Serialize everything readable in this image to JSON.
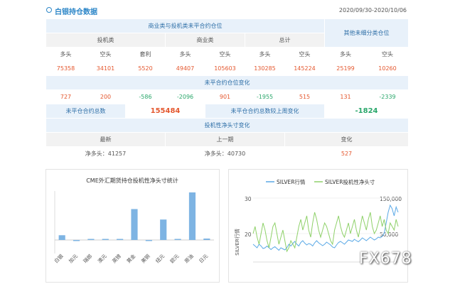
{
  "header": {
    "title": "白银持仓数据",
    "date_range": "2020/09/30-2020/10/06"
  },
  "table": {
    "group_noncommercial": "商业类与投机类未平合约仓位",
    "group_other": "其他未细分类仓位",
    "sub_speculative": "投机类",
    "sub_commercial": "商业类",
    "sub_total": "总计",
    "col_long": "多头",
    "col_short": "空头",
    "col_spread": "套利",
    "values": [
      "75358",
      "34101",
      "5520",
      "49407",
      "105603",
      "130285",
      "145224",
      "25199",
      "10260"
    ],
    "change_title": "未平合约仓位变化",
    "changes": [
      "727",
      "200",
      "-586",
      "-2096",
      "901",
      "-1955",
      "515",
      "131",
      "-2339"
    ],
    "oi_label": "未平仓合约总数",
    "oi_value": "155484",
    "oi_change_label": "未平仓合约总数较上周变化",
    "oi_change_value": "-1824",
    "spec_title": "投机性净头寸变化",
    "spec_latest": "最新",
    "spec_prev": "上一期",
    "spec_change": "变化",
    "spec_latest_value": "净多头：41257",
    "spec_prev_value": "净多头：40730",
    "spec_change_value": "527"
  },
  "chart_data": [
    {
      "type": "bar",
      "title": "CME外汇期货持仓投机性净头寸统计",
      "categories": [
        "白银",
        "加元",
        "瑞郎",
        "澳元",
        "英镑",
        "黄金",
        "美铜",
        "纽元",
        "欧元",
        "原油",
        "日元"
      ],
      "values": [
        10,
        -2,
        2,
        0,
        1,
        65,
        -1,
        43,
        1,
        100,
        3
      ],
      "color": "#7eb4e3"
    },
    {
      "type": "line",
      "legend": [
        "SILVER行情",
        "SILVER投机性净头寸"
      ],
      "ylabel": "SILVER行情",
      "yticks": [
        "30",
        "20"
      ],
      "y2ticks": [
        "150,000",
        "50,000"
      ],
      "series": [
        {
          "name": "SILVER行情",
          "color": "#5aa9e6",
          "values": [
            17,
            16.5,
            16,
            17,
            16.5,
            15.8,
            16,
            16.5,
            16,
            15.5,
            16,
            16.3,
            15.8,
            15.3,
            16,
            15.7,
            15.4,
            16,
            17,
            16.5,
            17.2,
            17.8,
            17,
            16.5,
            17.5,
            18,
            17.3,
            16.8,
            17.2,
            17,
            16.5,
            17.4,
            18,
            17.4,
            17,
            16.6,
            17,
            17.6,
            17.2,
            16.8,
            16.2,
            16,
            16.8,
            17.5,
            17.8,
            17.4,
            17,
            17.6,
            18.2,
            18,
            17.8,
            18.4,
            18,
            17.7,
            18.2,
            18.8,
            18.4,
            18,
            18.5,
            19,
            18.6,
            18.2,
            18.5,
            19,
            18.8,
            19.2,
            20,
            23,
            26,
            28,
            27,
            25,
            27.5,
            26
          ]
        },
        {
          "name": "SILVER投机性净头寸",
          "color": "#8fd16a",
          "values": [
            20,
            22,
            19,
            17,
            20,
            23,
            21,
            18,
            16,
            19,
            22,
            23,
            20,
            17,
            19,
            21,
            18,
            15,
            16,
            18,
            17,
            16,
            19,
            22,
            24,
            21,
            23,
            25,
            21,
            19,
            23,
            26,
            24,
            21,
            19,
            21,
            23,
            22,
            20,
            18,
            17,
            21,
            23,
            25,
            22,
            20,
            19,
            21,
            23,
            20,
            22,
            24,
            21,
            19,
            22,
            25,
            23,
            21,
            24,
            26,
            22,
            20,
            21,
            23,
            25,
            22,
            24,
            21,
            20,
            23,
            22,
            21,
            24,
            22
          ]
        }
      ]
    }
  ]
}
